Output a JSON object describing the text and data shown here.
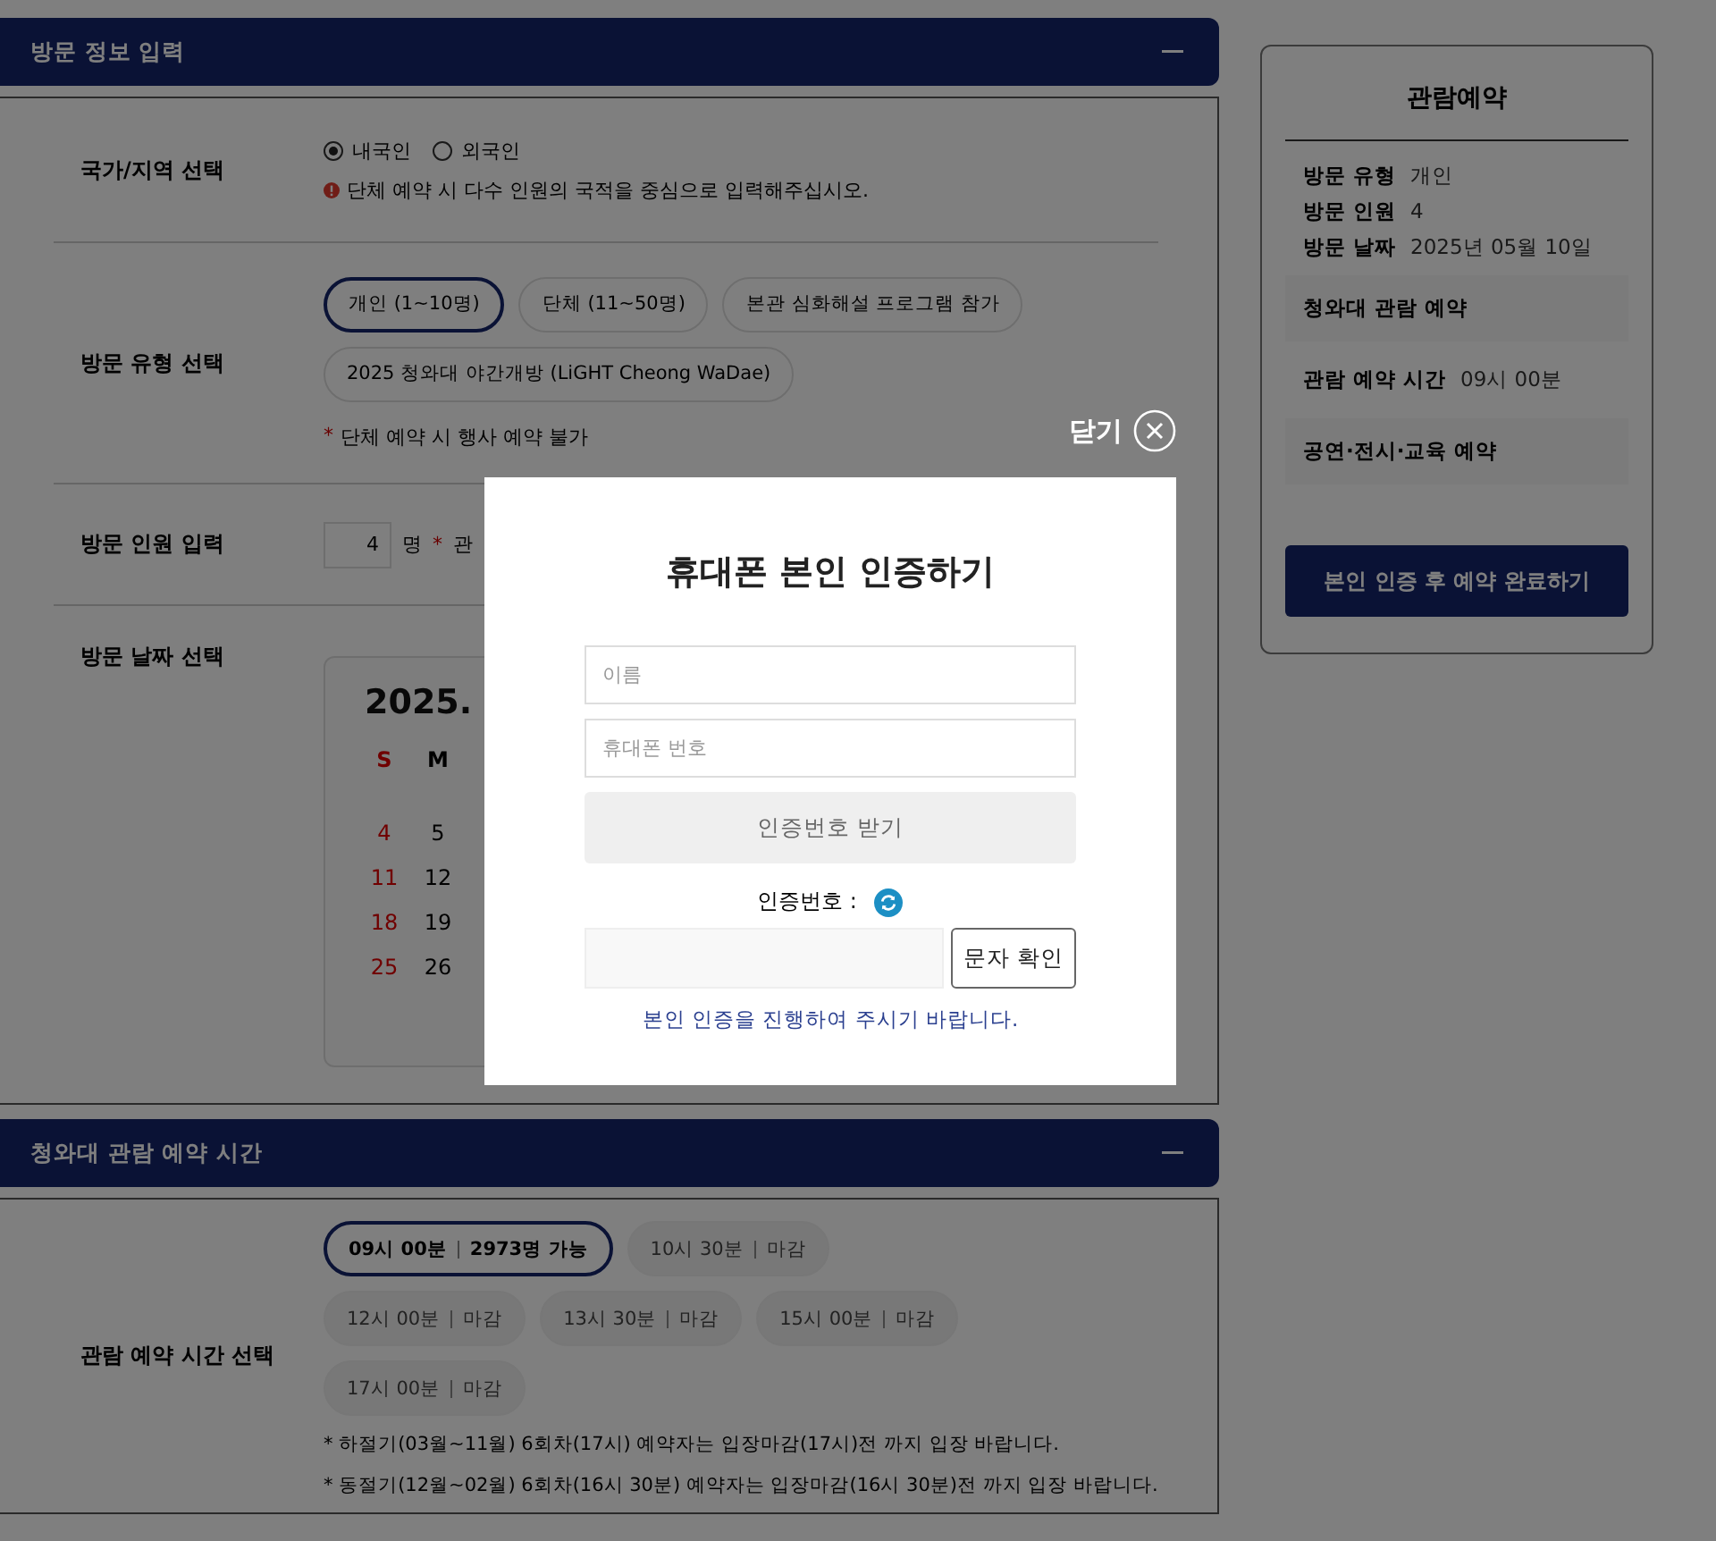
{
  "visit_info": {
    "title": "방문 정보 입력",
    "nationality": {
      "label": "국가/지역 선택",
      "options": [
        {
          "label": "내국인",
          "selected": true
        },
        {
          "label": "외국인",
          "selected": false
        }
      ],
      "note": "단체 예약 시 다수 인원의 국적을 중심으로 입력해주십시오."
    },
    "visit_type": {
      "label": "방문 유형 선택",
      "options": [
        {
          "label": "개인 (1~10명)",
          "selected": true
        },
        {
          "label": "단체 (11~50명)",
          "selected": false
        },
        {
          "label": "본관 심화해설 프로그램 참가",
          "selected": false
        },
        {
          "label": "2025 청와대 야간개방 (LiGHT Cheong WaDae)",
          "selected": false
        }
      ],
      "note_mark": "*",
      "note": "단체 예약 시 행사 예약 불가"
    },
    "visitors": {
      "label": "방문 인원 입력",
      "value": "4",
      "unit": "명",
      "note_mark": "*",
      "note": "관"
    },
    "date": {
      "label": "방문 날짜 선택",
      "month": "2025.",
      "weekdays": [
        "S",
        "M"
      ],
      "weeks": [
        [
          "4",
          "5"
        ],
        [
          "11",
          "12"
        ],
        [
          "18",
          "19"
        ],
        [
          "25",
          "26"
        ]
      ]
    }
  },
  "time_section": {
    "title": "청와대 관람 예약 시간",
    "label": "관람 예약 시간 선택",
    "slots": [
      {
        "time": "09시 00분",
        "status": "2973명 가능",
        "selected": true,
        "disabled": false
      },
      {
        "time": "10시 30분",
        "status": "마감",
        "selected": false,
        "disabled": true
      },
      {
        "time": "12시 00분",
        "status": "마감",
        "selected": false,
        "disabled": true
      },
      {
        "time": "13시 30분",
        "status": "마감",
        "selected": false,
        "disabled": true
      },
      {
        "time": "15시 00분",
        "status": "마감",
        "selected": false,
        "disabled": true
      },
      {
        "time": "17시 00분",
        "status": "마감",
        "selected": false,
        "disabled": true
      }
    ],
    "notes": [
      "* 하절기(03월~11월) 6회차(17시) 예약자는 입장마감(17시)전 까지 입장 바랍니다.",
      "* 동절기(12월~02월) 6회차(16시 30분) 예약자는 입장마감(16시 30분)전 까지 입장 바랍니다."
    ]
  },
  "summary": {
    "title": "관람예약",
    "items": [
      {
        "label": "방문 유형",
        "value": "개인"
      },
      {
        "label": "방문 인원",
        "value": "4"
      },
      {
        "label": "방문 날짜",
        "value": "2025년 05월 10일"
      }
    ],
    "tour_heading": "청와대 관람 예약",
    "time_label": "관람 예약 시간",
    "time_value": "09시 00분",
    "program_heading": "공연·전시·교육 예약",
    "submit": "본인 인증 후 예약 완료하기"
  },
  "modal": {
    "close": "닫기",
    "title": "휴대폰 본인 인증하기",
    "name_placeholder": "이름",
    "phone_placeholder": "휴대폰 번호",
    "request_button": "인증번호 받기",
    "code_label": "인증번호 :",
    "confirm_button": "문자 확인",
    "message": "본인 인증을 진행하여 주시기 바랍니다."
  }
}
